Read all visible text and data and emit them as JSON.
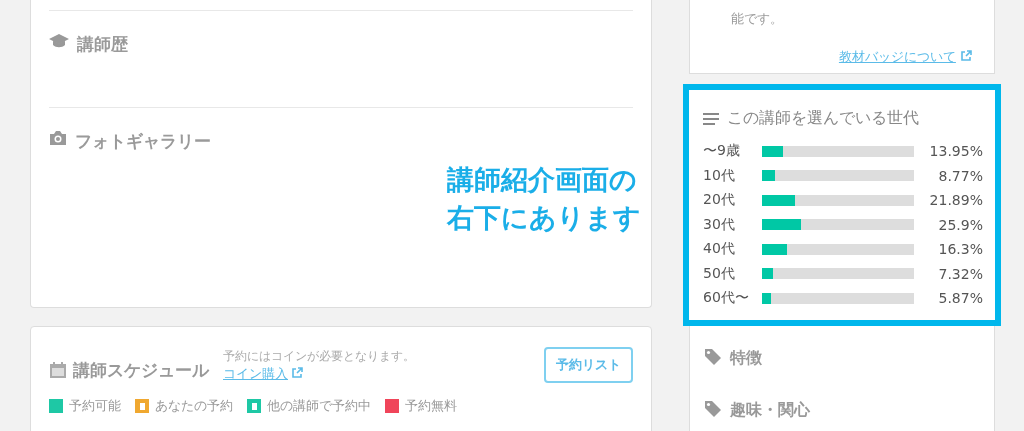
{
  "profile_card": {
    "sections": [
      {
        "kind": "history",
        "title": "講師歴"
      },
      {
        "kind": "gallery",
        "title": "フォトギャラリー"
      }
    ]
  },
  "schedule_card": {
    "title": "講師スケジュール",
    "note": "予約にはコインが必要となります。",
    "link": "コイン購入",
    "button": "予約リスト",
    "legend": [
      {
        "kind": "solid",
        "label": "予約可能",
        "color": "#1ec8a5"
      },
      {
        "kind": "marked",
        "label": "あなたの予約",
        "color": "#f0a830"
      },
      {
        "kind": "marked",
        "label": "他の講師で予約中",
        "color": "#1ec8a5"
      },
      {
        "kind": "solid",
        "label": "予約無料",
        "color": "#f0455a"
      }
    ]
  },
  "badge_card": {
    "text": "能です。",
    "link": "教材バッジについて"
  },
  "age_chart": {
    "title": "この講師を選んでいる世代",
    "rows": [
      {
        "label": "〜9歳",
        "level": 0.1395,
        "reading": "13.95%"
      },
      {
        "label": "10代",
        "level": 0.0877,
        "reading": "8.77%"
      },
      {
        "label": "20代",
        "level": 0.2189,
        "reading": "21.89%"
      },
      {
        "label": "30代",
        "level": 0.259,
        "reading": "25.9%"
      },
      {
        "label": "40代",
        "level": 0.163,
        "reading": "16.3%"
      },
      {
        "label": "50代",
        "level": 0.0732,
        "reading": "7.32%"
      },
      {
        "label": "60代〜",
        "level": 0.0587,
        "reading": "5.87%"
      }
    ]
  },
  "tag_sections": [
    {
      "title": "特徴"
    },
    {
      "title": "趣味・関心"
    }
  ],
  "annotation": {
    "lines": [
      "講師紹介画面の",
      "右下にあります"
    ]
  }
}
